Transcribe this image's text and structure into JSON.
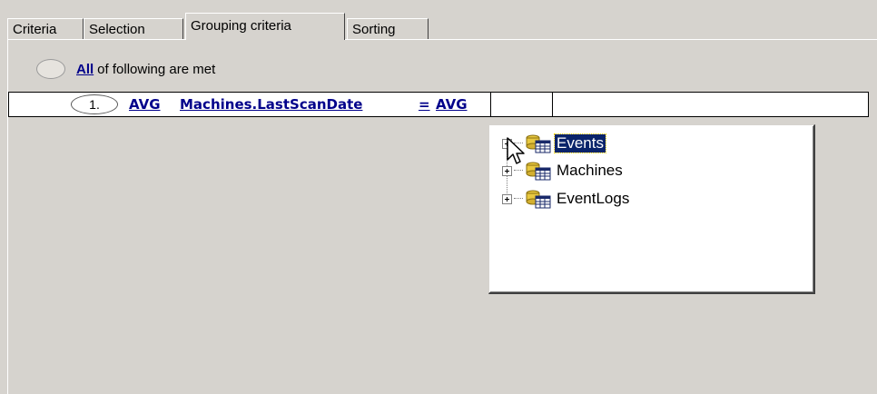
{
  "tabs": [
    {
      "label": "Criteria",
      "active": false
    },
    {
      "label": "Selection",
      "active": false
    },
    {
      "label": "Grouping criteria",
      "active": true
    },
    {
      "label": "Sorting",
      "active": false
    }
  ],
  "group": {
    "quantifier": "All",
    "suffix": "of following are met"
  },
  "condition": {
    "number": "1.",
    "left_aggregate": "AVG",
    "field": "Machines.LastScanDate",
    "operator": "=",
    "right_aggregate": "AVG",
    "value": ""
  },
  "tree_popup": {
    "items": [
      {
        "label": "Events",
        "selected": true,
        "icon": "table-icon"
      },
      {
        "label": "Machines",
        "selected": false,
        "icon": "table-icon"
      },
      {
        "label": "EventLogs",
        "selected": false,
        "icon": "table-icon"
      }
    ]
  },
  "colors": {
    "background": "#d6d3ce",
    "link": "#00008b",
    "selection": "#0a246a"
  }
}
